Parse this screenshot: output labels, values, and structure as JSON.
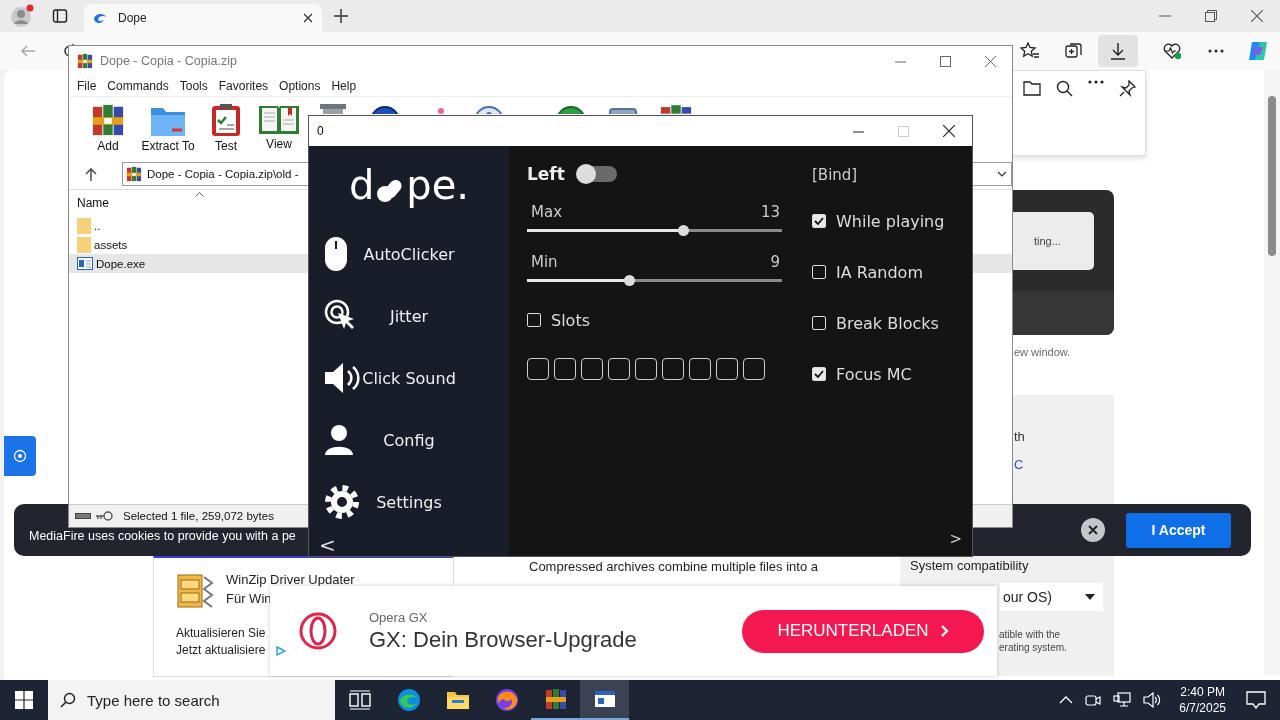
{
  "browser": {
    "tabs": [
      {
        "title": "Dope",
        "selected": true
      }
    ],
    "page": {
      "loading_text": "ting...",
      "note": "ew window.",
      "side_text": "th",
      "side_link": "C",
      "cookie_banner": {
        "text": "MediaFire uses cookies to provide you with a pe",
        "button": "I Accept"
      },
      "winzip_card": {
        "title": "WinZip Driver Updater",
        "subtitle": "Für Win",
        "lines": [
          "Aktualisieren Sie",
          "Jetzt aktualisiere"
        ]
      },
      "description": "Compressed archives combine multiple files into a",
      "compatibility": {
        "label": "System compatibility",
        "select": "our OS)",
        "note": [
          "atible with the",
          "erating system."
        ]
      },
      "ad": {
        "brand": "Opera GX",
        "headline": "GX: Dein Browser-Upgrade",
        "button": "HERUNTERLADEN"
      }
    }
  },
  "winrar": {
    "title": "Dope - Copia - Copia.zip",
    "menu": [
      "File",
      "Commands",
      "Tools",
      "Favorites",
      "Options",
      "Help"
    ],
    "toolbar": [
      {
        "kind": "add",
        "label": "Add"
      },
      {
        "kind": "extract",
        "label": "Extract To"
      },
      {
        "kind": "test",
        "label": "Test"
      },
      {
        "kind": "view",
        "label": "View"
      }
    ],
    "path": "Dope - Copia - Copia.zip\\old -",
    "columns": [
      "Name"
    ],
    "files": [
      {
        "name": "..",
        "kind": "folder",
        "selected": false
      },
      {
        "name": "assets",
        "kind": "folder",
        "selected": false
      },
      {
        "name": "Dope.exe",
        "kind": "exe",
        "selected": true
      }
    ],
    "status": "Selected 1 file, 259,072 bytes"
  },
  "dope": {
    "title": "0",
    "logo": {
      "before": "d",
      "after": "pe."
    },
    "nav": [
      {
        "kind": "mouse",
        "label": "AutoClicker"
      },
      {
        "kind": "target",
        "label": "Jitter"
      },
      {
        "kind": "speaker",
        "label": "Click Sound"
      },
      {
        "kind": "person",
        "label": "Config"
      },
      {
        "kind": "gear",
        "label": "Settings"
      }
    ],
    "toggle": {
      "label": "Left",
      "on": false
    },
    "sliders": [
      {
        "label": "Max",
        "reading": "13",
        "level": 0.61
      },
      {
        "label": "Min",
        "reading": "9",
        "level": 0.4
      }
    ],
    "slots": {
      "label": "Slots",
      "checked": false
    },
    "slot_boxes": [
      {
        "filled": false
      },
      {
        "filled": false
      },
      {
        "filled": false
      },
      {
        "filled": false
      },
      {
        "filled": false
      },
      {
        "filled": false
      },
      {
        "filled": false
      },
      {
        "filled": false
      },
      {
        "filled": false
      }
    ],
    "bind": "[Bind]",
    "options": [
      {
        "label": "While playing",
        "checked": true
      },
      {
        "label": "IA Random",
        "checked": false
      },
      {
        "label": "Break Blocks",
        "checked": false
      },
      {
        "label": "Focus MC",
        "checked": true
      }
    ],
    "prev": "<",
    "next": ">"
  },
  "taskbar": {
    "search_placeholder": "Type here to search",
    "apps": [
      {
        "kind": "taskview",
        "open": false,
        "selected": false
      },
      {
        "kind": "edge",
        "open": false,
        "selected": false
      },
      {
        "kind": "explorer",
        "open": false,
        "selected": false
      },
      {
        "kind": "firefox",
        "open": false,
        "selected": false
      },
      {
        "kind": "winrar",
        "open": true,
        "selected": false
      },
      {
        "kind": "app",
        "open": true,
        "selected": true
      }
    ],
    "time": "2:40 PM",
    "date": "6/7/2025"
  }
}
